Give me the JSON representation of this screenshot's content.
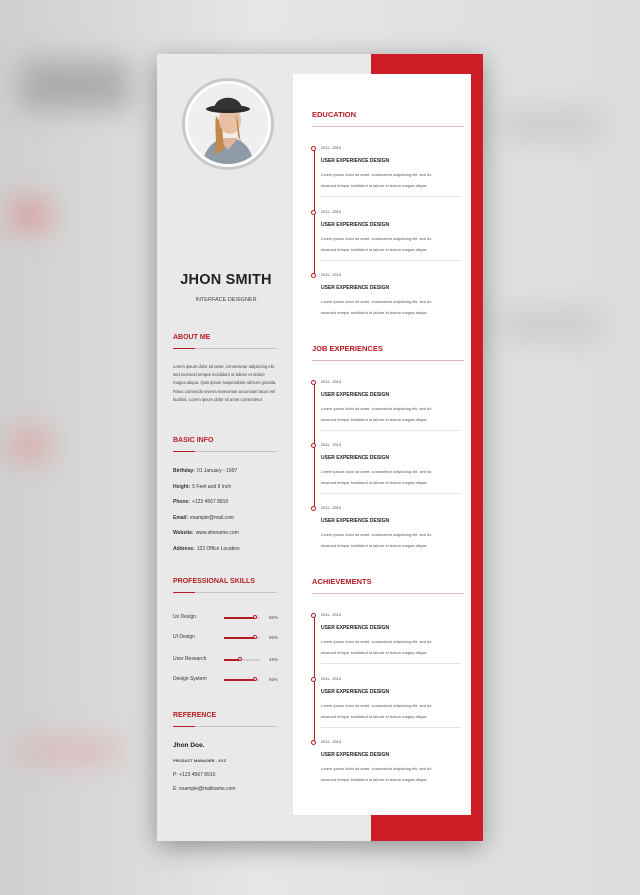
{
  "profile": {
    "name": "JHON SMITH",
    "role": "INTERFACE DESIGNER"
  },
  "about": {
    "title": "ABOUT ME",
    "text": "Lorem ipsum dolor sit amet, consectetur adipiscing elit, sed eiusmod tempor incididunt ut labore et dolore magna aliqua. Quis ipsum suspendisse ultrices gravida. Risus commodo viverra maecenas accumsan lacus vel facilisis. Lorem ipsum dolor sit amet consectetur."
  },
  "basic_info": {
    "title": "BASIC INFO",
    "rows": [
      {
        "label": "Birthday:",
        "value": "01 January - 1997"
      },
      {
        "label": "Height:",
        "value": "5 Feet and 9 Inch"
      },
      {
        "label": "Phone:",
        "value": "+123 4567 8910"
      },
      {
        "label": "Email:",
        "value": "example@mail.com"
      },
      {
        "label": "Website:",
        "value": "www.sitename.com"
      },
      {
        "label": "Address:",
        "value": "123 Office Location"
      }
    ]
  },
  "skills": {
    "title": "PROFESSIONAL SKILLS",
    "items": [
      {
        "label": "Ux Design",
        "percent": "86%",
        "level": 0.86
      },
      {
        "label": "UI Design",
        "percent": "85%",
        "level": 0.85
      },
      {
        "label": "User Research",
        "percent": "45%",
        "level": 0.45
      },
      {
        "label": "Design System",
        "percent": "86%",
        "level": 0.86
      }
    ]
  },
  "reference": {
    "title": "REFERENCE",
    "name": "Jhon Doe.",
    "role": "PRODUCT MANAGER - XYZ",
    "phone": "P: +123 4567 8910",
    "email": "E: example@mailname.com"
  },
  "education": {
    "title": "EDUCATION",
    "entries": [
      {
        "year": "2011 - 2013",
        "title": "USER EXPERIENCE DESIGN",
        "desc": "Lorem ipsum dolor sit amet, consectetur adipiscing elit, sed do eiusmod tempor incididunt ut labore et dolore magna aliqua."
      },
      {
        "year": "2011 - 2013",
        "title": "USER EXPERIENCE DESIGN",
        "desc": "Lorem ipsum dolor sit amet, consectetur adipiscing elit, sed do eiusmod tempor incididunt ut labore et dolore magna aliqua."
      },
      {
        "year": "2011 - 2013",
        "title": "USER EXPERIENCE DESIGN",
        "desc": "Lorem ipsum dolor sit amet, consectetur adipiscing elit, sed do eiusmod tempor incididunt ut labore et dolore magna aliqua."
      }
    ]
  },
  "jobs": {
    "title": "JOB EXPERIENCES",
    "entries": [
      {
        "year": "2011 - 2013",
        "title": "USER EXPERIENCE DESIGN",
        "desc": "Lorem ipsum dolor sit amet, consectetur adipiscing elit, sed do eiusmod tempor incididunt ut labore et dolore magna aliqua."
      },
      {
        "year": "2011 - 2013",
        "title": "USER EXPERIENCE DESIGN",
        "desc": "Lorem ipsum dolor sit amet, consectetur adipiscing elit, sed do eiusmod tempor incididunt ut labore et dolore magna aliqua."
      },
      {
        "year": "2011 - 2013",
        "title": "USER EXPERIENCE DESIGN",
        "desc": "Lorem ipsum dolor sit amet, consectetur adipiscing elit, sed do eiusmod tempor incididunt ut labore et dolore magna aliqua."
      }
    ]
  },
  "achievements": {
    "title": "ACHIEVEMENTS",
    "entries": [
      {
        "year": "2011 - 2013",
        "title": "USER EXPERIENCE DESIGN",
        "desc": "Lorem ipsum dolor sit amet, consectetur adipiscing elit, sed do eiusmod tempor incididunt ut labore et dolore magna aliqua."
      },
      {
        "year": "2011 - 2013",
        "title": "USER EXPERIENCE DESIGN",
        "desc": "Lorem ipsum dolor sit amet, consectetur adipiscing elit, sed do eiusmod tempor incididunt ut labore et dolore magna aliqua."
      },
      {
        "year": "2011 - 2013",
        "title": "USER EXPERIENCE DESIGN",
        "desc": "Lorem ipsum dolor sit amet, consectetur adipiscing elit, sed do eiusmod tempor incididunt ut labore et dolore magna aliqua."
      }
    ]
  },
  "colors": {
    "accent": "#cc1d26",
    "sidebar": "#e9e9e9",
    "panel": "#ffffff"
  }
}
